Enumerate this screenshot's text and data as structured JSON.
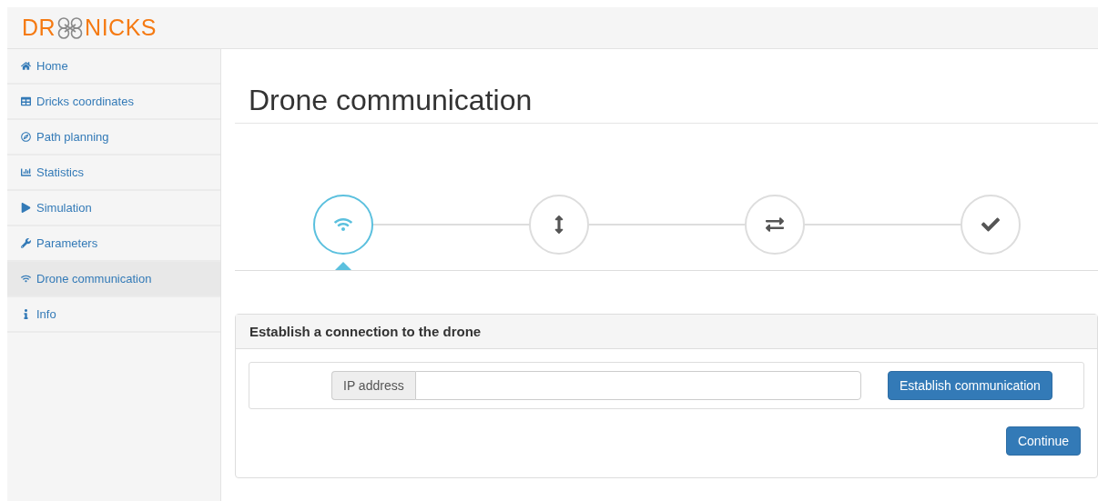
{
  "brand": {
    "before": "DR",
    "after": "NICKS"
  },
  "sidebar": {
    "items": [
      {
        "label": "Home",
        "selected": false
      },
      {
        "label": "Dricks coordinates",
        "selected": false
      },
      {
        "label": "Path planning",
        "selected": false
      },
      {
        "label": "Statistics",
        "selected": false
      },
      {
        "label": "Simulation",
        "selected": false
      },
      {
        "label": "Parameters",
        "selected": false
      },
      {
        "label": "Drone communication",
        "selected": true
      },
      {
        "label": "Info",
        "selected": false
      }
    ]
  },
  "page_title": "Drone communication",
  "steps": [
    {
      "selected": true
    },
    {
      "selected": false
    },
    {
      "selected": false
    },
    {
      "selected": false
    }
  ],
  "panel": {
    "title": "Establish a connection to the drone",
    "addon": "IP address",
    "connect_button": "Establish communication",
    "continue_button": "Continue"
  }
}
